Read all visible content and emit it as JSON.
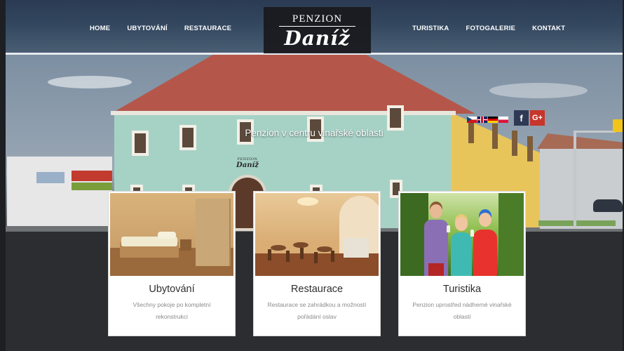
{
  "nav": {
    "left": [
      "HOME",
      "UBYTOVÁNÍ",
      "RESTAURACE"
    ],
    "right": [
      "TURISTIKA",
      "FOTOGALERIE",
      "KONTAKT"
    ]
  },
  "logo": {
    "top": "PENZION",
    "script": "Daníž"
  },
  "facade_logo": {
    "top": "PENZION",
    "script": "Daníž"
  },
  "hero": {
    "tagline": "Penzion v centru vinařské oblasti"
  },
  "languages": [
    {
      "code": "cs",
      "icon": "flag-cz-icon"
    },
    {
      "code": "en",
      "icon": "flag-gb-icon"
    },
    {
      "code": "de",
      "icon": "flag-de-icon"
    },
    {
      "code": "pl",
      "icon": "flag-pl-icon"
    }
  ],
  "social": {
    "facebook": "f",
    "googleplus": "G+"
  },
  "cards": [
    {
      "title": "Ubytování",
      "text": "Všechny pokoje po kompletní rekonstrukci",
      "image": "bedroom-photo"
    },
    {
      "title": "Restaurace",
      "text": "Restaurace se zahrádkou a možností pořádání oslav",
      "image": "restaurant-photo"
    },
    {
      "title": "Turistika",
      "text": "Penzion uprostřed nádherné vinařské oblasti",
      "image": "vineyard-photo"
    }
  ],
  "colors": {
    "nav_bg": "#33475f",
    "logo_bg": "#19191c",
    "facebook": "#2e3a55",
    "googleplus": "#c8352b",
    "card_title": "#2f2f2f",
    "card_text": "#8a8a8a"
  }
}
